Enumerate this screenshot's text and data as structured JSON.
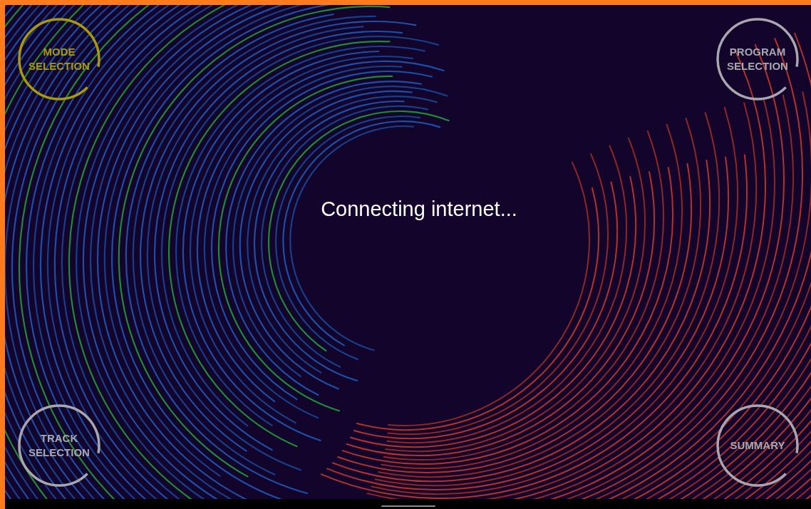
{
  "nav_buttons": [
    {
      "lines": [
        "MODE",
        "SELECTION"
      ],
      "selected": true
    },
    {
      "lines": [
        "PROGRAM",
        "SELECTION"
      ],
      "selected": false
    },
    {
      "lines": [
        "TRACK",
        "SELECTION"
      ],
      "selected": false
    },
    {
      "lines": [
        "SUMMARY"
      ],
      "selected": false
    }
  ],
  "status_message": "Connecting internet..."
}
